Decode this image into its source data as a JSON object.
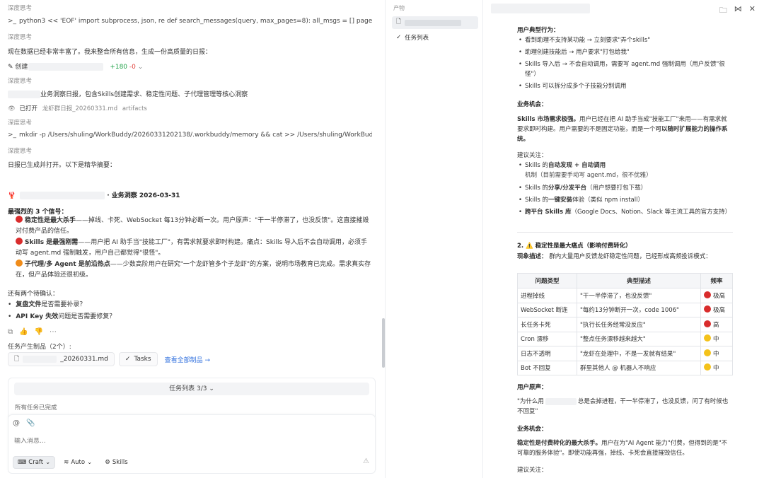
{
  "chat": {
    "thinking_label": "深度思考",
    "shell1": "python3 << 'EOF' import subprocess, json, re def search_messages(query, max_pages=8): all_msgs = [] page_to...",
    "line_enriched": "现在数据已经非常丰富了。我来整合所有信息，生成一份高质量的日报：",
    "create_label": "创建",
    "diff_add": "+180",
    "diff_del": "-0",
    "summary_line": "业务洞察日报，包含Skills创建需求、稳定性问题、子代理管理等核心洞察",
    "opened_label": "已打开",
    "opened_file": "龙虾群日报_20260331.md",
    "opened_tag": "artifacts",
    "shell2": "mkdir -p /Users/shuling/WorkBuddy/20260331202138/.workbuddy/memory && cat >> /Users/shuling/WorkBuddy/202...",
    "report_done": "日报已生成并打开。以下是精华摘要：",
    "report_title": "· 业务洞察 2026-03-31",
    "signals_head": "最强烈的 3 个信号：",
    "signals": [
      {
        "bold": "稳定性是最大杀手",
        "text": "——掉线、卡死、WebSocket 每13分钟必断一次。用户原声：\"干一半停滞了，也没反馈\"。这直接摧毁对付费产品的信任。"
      },
      {
        "bold": "Skills 是最强刚需",
        "text": "——用户把 AI 助手当\"技能工厂\"，有需求就要求即时构建。痛点：Skills 导入后不会自动调用，必须手动写 agent.md 强制触发，用户自己都觉得\"很怪\"。"
      },
      {
        "bold": "子代理/多 Agent 是前沿热点",
        "text": "——少数高阶用户在研究\"一个龙虾管多个子龙虾\"的方案，说明市场教育已完成。需求真实存在，但产品体验还很初级。"
      }
    ],
    "confirm_head": "还有两个待确认：",
    "confirm_items": [
      {
        "bold": "复盘文件",
        "text": "是否需要补录？"
      },
      {
        "bold": "API Key 失效",
        "text": "问题是否需要修复？"
      }
    ],
    "artifacts_head": "任务产生制品（2个）:",
    "artifact_file": "_20260331.md",
    "artifact_tasks": "Tasks",
    "view_all": "查看全部制品 →",
    "task_list": "任务列表 3/3",
    "task_done": "所有任务已完成",
    "input_placeholder": "输入消息...",
    "btn_craft": "Craft",
    "btn_auto": "Auto",
    "btn_skills": "Skills"
  },
  "files": {
    "head": "产物",
    "task_list": "任务列表"
  },
  "doc": {
    "typical_head": "用户典型行为：",
    "typical": [
      "看到助理不支持某功能 → 立刻要求\"弄个skills\"",
      "助理创建技能后 → 用户要求\"打包给我\"",
      "Skills 导入后 → 不会自动调用，需要写 agent.md 强制调用（用户反馈\"很怪\"）",
      "Skills 可以拆分成多个子技能分别调用"
    ],
    "opp_head": "业务机会：",
    "opp_bold": "Skills 市场需求极强。",
    "opp_text1": "用户已经在把 AI 助手当成\"技能工厂\"来用——有需求就要求即时构建。用户需要的不是固定功能，而是一个",
    "opp_bold2": "可以随时扩展能力的操作系统。",
    "suggest_head": "建议关注：",
    "suggest": [
      {
        "pre": "Skills 的",
        "bold": "自动发现 + 自动调用",
        "post": "",
        "sub": "机制（目前需要手动写 agent.md，很不优雅）"
      },
      {
        "pre": "Skills 的",
        "bold": "分享/分发平台",
        "post": "（用户想要打包下载）",
        "sub": ""
      },
      {
        "pre": "Skills 的",
        "bold": "一键安装",
        "post": "体验（类似 npm install）",
        "sub": ""
      },
      {
        "pre": "",
        "bold": "跨平台 Skills 库",
        "post": "（Google Docs、Notion、Slack 等主流工具的官方支持）",
        "sub": ""
      }
    ],
    "sec2_title": "2. ⚠️ 稳定性是最大痛点（影响付费转化）",
    "phen_bold": "现象描述：",
    "phen_text": "群内大量用户反馈龙虾稳定性问题，已经形成高频投诉模式：",
    "table_headers": [
      "问题类型",
      "典型描述",
      "频率"
    ],
    "table_rows": [
      {
        "type": "进程掉线",
        "desc": "\"干一半停滞了，也没反馈\"",
        "freq": "极高",
        "color": "#d92c2c"
      },
      {
        "type": "WebSocket 断连",
        "desc": "\"每约13分钟断开一次，code 1006\"",
        "freq": "极高",
        "color": "#d92c2c"
      },
      {
        "type": "长任务卡死",
        "desc": "\"执行长任务经常没反应\"",
        "freq": "高",
        "color": "#d92c2c"
      },
      {
        "type": "Cron 漂移",
        "desc": "\"整点任务漂移越来越大\"",
        "freq": "中",
        "color": "#f4c21a"
      },
      {
        "type": "日志不透明",
        "desc": "\"龙虾在处理中，不是一发就有结果\"",
        "freq": "中",
        "color": "#f4c21a"
      },
      {
        "type": "Bot 不回复",
        "desc": "群里其他人 @ 机器人不响应",
        "freq": "中",
        "color": "#f4c21a"
      }
    ],
    "voice_head": "用户原声：",
    "voice_pre": "\"为什么用",
    "voice_post": "总是会掉进程，干一半停滞了，也没反馈，问了有时候也不回复\"",
    "opp2_head": "业务机会：",
    "opp2_bold": "稳定性是付费转化的最大杀手。",
    "opp2_text": "用户在为\"AI Agent 能力\"付费，但得到的是\"不可靠的服务体验\"。即使功能再强，掉线、卡死会直接摧毁信任。",
    "suggest2_head": "建议关注："
  }
}
